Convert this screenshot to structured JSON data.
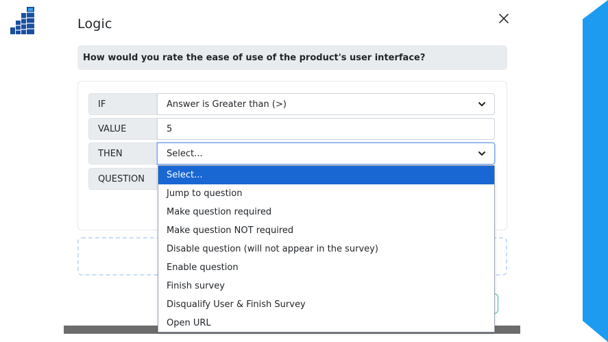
{
  "modal": {
    "title": "Logic",
    "question": "How would you rate the ease of use of the product's user interface?"
  },
  "rows": {
    "if": {
      "label": "IF",
      "value": "Answer is Greater than (>)"
    },
    "value": {
      "label": "VALUE",
      "value": "5"
    },
    "then": {
      "label": "THEN",
      "value": "Select..."
    },
    "question": {
      "label": "QUESTION"
    }
  },
  "then_options": [
    "Select...",
    "Jump to question",
    "Make question required",
    "Make question NOT required",
    "Disable question (will not appear in the survey)",
    "Enable question",
    "Finish survey",
    "Disqualify User & Finish Survey",
    "Open URL"
  ],
  "selected_option": "Select...",
  "colors": {
    "brand_blue": "#1d9bf0",
    "selected_option": "#1967d2",
    "label_bg": "#e9ecef",
    "accent_teal": "#3db6a8"
  },
  "icons": {
    "logo": "bar-chart-stairs-logo",
    "close": "close-icon",
    "chevron": "chevron-down-icon"
  }
}
